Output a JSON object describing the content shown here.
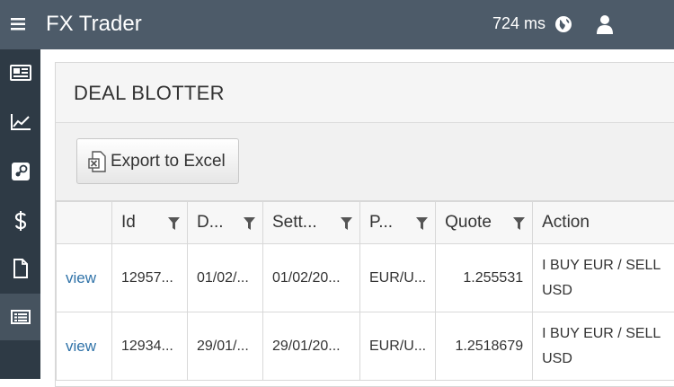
{
  "app": {
    "title": "FX Trader",
    "latency": "724 ms"
  },
  "header_icons": [
    "menu-icon",
    "globe-icon",
    "user-icon"
  ],
  "sidebar": {
    "items": [
      {
        "icon": "newspaper-icon"
      },
      {
        "icon": "line-chart-icon"
      },
      {
        "icon": "steam-icon"
      },
      {
        "icon": "dollar-icon"
      },
      {
        "icon": "document-icon"
      },
      {
        "icon": "list-icon",
        "active": true
      }
    ]
  },
  "blotter": {
    "title": "DEAL BLOTTER",
    "export_label": "Export to Excel",
    "columns": [
      "",
      "Id",
      "D...",
      "Sett...",
      "P...",
      "Quote",
      "Action"
    ],
    "rows": [
      {
        "view": "view",
        "id": "12957...",
        "date": "01/02/...",
        "settle": "01/02/20...",
        "pair": "EUR/U...",
        "quote": "1.255531",
        "action": "I BUY EUR / SELL USD"
      },
      {
        "view": "view",
        "id": "12934...",
        "date": "29/01/...",
        "settle": "29/01/20...",
        "pair": "EUR/U...",
        "quote": "1.2518679",
        "action": "I BUY EUR / SELL USD"
      }
    ]
  },
  "colors": {
    "header": "#4d5b69",
    "sidebar": "#2e3a45",
    "link": "#2f72a8"
  }
}
